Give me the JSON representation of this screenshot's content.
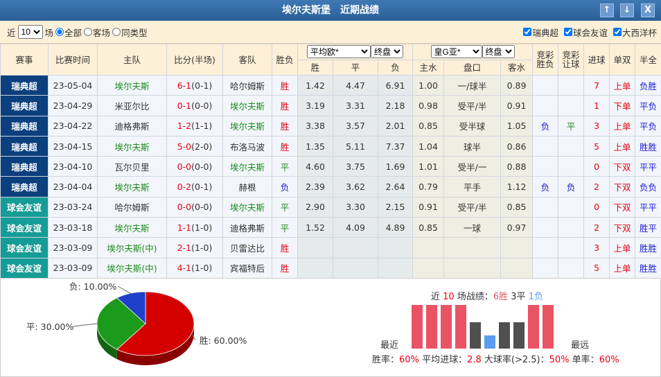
{
  "title": "埃尔夫斯堡　近期战绩",
  "titlebar_buttons": {
    "up": "↑",
    "down": "↓",
    "close": "X"
  },
  "filter": {
    "near": "近",
    "count": "10",
    "unit": "场",
    "radio": [
      "全部",
      "客场",
      "同类型"
    ],
    "checks": [
      "瑞典超",
      "球会友谊",
      "大西洋杯"
    ]
  },
  "headers": {
    "league": "赛事",
    "date": "比赛时间",
    "home": "主队",
    "score": "比分(半场)",
    "away": "客队",
    "result": "胜负",
    "euro_select": "平均欧*",
    "euro_stage": "终盘",
    "asia_select": "皇G亚*",
    "asia_stage": "终盘",
    "win": "胜",
    "draw": "平",
    "lose": "负",
    "home_water": "主水",
    "handicap": "盘口",
    "away_water": "客水",
    "jc_result": "竞彩胜负",
    "jc_handicap": "竞彩让球",
    "goals": "进球",
    "odd_even": "单双",
    "ht_ft": "半全"
  },
  "rows": [
    {
      "league": "瑞典超",
      "lt": 1,
      "date": "23-05-04",
      "home": "埃尔夫斯",
      "hg": 1,
      "sc": "6-1",
      "ht": "(0-1)",
      "away": "哈尔姆斯",
      "ag": 0,
      "res": "胜",
      "w": "1.42",
      "d": "4.47",
      "l": "6.91",
      "hw": "1.00",
      "hc": "一/球半",
      "aw": "0.89",
      "jr": "",
      "jh": "",
      "goals": "7",
      "oe": "上单",
      "hf": "负胜"
    },
    {
      "league": "瑞典超",
      "lt": 1,
      "date": "23-04-29",
      "home": "米亚尔比",
      "hg": 0,
      "sc": "0-1",
      "ht": "(0-0)",
      "away": "埃尔夫斯",
      "ag": 1,
      "res": "胜",
      "w": "3.19",
      "d": "3.31",
      "l": "2.18",
      "hw": "0.98",
      "hc": "受平/半",
      "aw": "0.91",
      "jr": "",
      "jh": "",
      "goals": "1",
      "oe": "下单",
      "hf": "平负"
    },
    {
      "league": "瑞典超",
      "lt": 1,
      "date": "23-04-22",
      "home": "迪格弗斯",
      "hg": 0,
      "sc": "1-2",
      "ht": "(1-1)",
      "away": "埃尔夫斯",
      "ag": 1,
      "res": "胜",
      "w": "3.38",
      "d": "3.57",
      "l": "2.01",
      "hw": "0.85",
      "hc": "受半球",
      "aw": "1.05",
      "jr": "负",
      "jh": "平",
      "goals": "3",
      "oe": "上单",
      "hf": "平负"
    },
    {
      "league": "瑞典超",
      "lt": 1,
      "date": "23-04-15",
      "home": "埃尔夫斯",
      "hg": 1,
      "sc": "5-0",
      "ht": "(2-0)",
      "away": "布洛马波",
      "ag": 0,
      "res": "胜",
      "w": "1.35",
      "d": "5.11",
      "l": "7.37",
      "hw": "1.04",
      "hc": "球半",
      "aw": "0.86",
      "jr": "",
      "jh": "",
      "goals": "5",
      "oe": "上单",
      "hf": "胜胜"
    },
    {
      "league": "瑞典超",
      "lt": 1,
      "date": "23-04-10",
      "home": "瓦尔贝里",
      "hg": 0,
      "sc": "0-0",
      "ht": "(0-0)",
      "away": "埃尔夫斯",
      "ag": 1,
      "res": "平",
      "w": "4.60",
      "d": "3.75",
      "l": "1.69",
      "hw": "1.01",
      "hc": "受半/一",
      "aw": "0.88",
      "jr": "",
      "jh": "",
      "goals": "0",
      "oe": "下双",
      "hf": "平平"
    },
    {
      "league": "瑞典超",
      "lt": 1,
      "date": "23-04-04",
      "home": "埃尔夫斯",
      "hg": 1,
      "sc": "0-2",
      "ht": "(0-1)",
      "away": "赫根",
      "ag": 0,
      "res": "负",
      "w": "2.39",
      "d": "3.62",
      "l": "2.64",
      "hw": "0.79",
      "hc": "平手",
      "aw": "1.12",
      "jr": "负",
      "jh": "负",
      "goals": "2",
      "oe": "下双",
      "hf": "负负"
    },
    {
      "league": "球会友谊",
      "lt": 2,
      "date": "23-03-24",
      "home": "哈尔姆斯",
      "hg": 0,
      "sc": "0-0",
      "ht": "(0-0)",
      "away": "埃尔夫斯",
      "ag": 1,
      "res": "平",
      "w": "2.90",
      "d": "3.30",
      "l": "2.15",
      "hw": "0.91",
      "hc": "受平/半",
      "aw": "0.85",
      "jr": "",
      "jh": "",
      "goals": "0",
      "oe": "下双",
      "hf": "平平"
    },
    {
      "league": "球会友谊",
      "lt": 2,
      "date": "23-03-18",
      "home": "埃尔夫斯",
      "hg": 1,
      "sc": "1-1",
      "ht": "(1-0)",
      "away": "迪格弗斯",
      "ag": 0,
      "res": "平",
      "w": "1.52",
      "d": "4.09",
      "l": "4.89",
      "hw": "0.85",
      "hc": "一球",
      "aw": "0.97",
      "jr": "",
      "jh": "",
      "goals": "2",
      "oe": "下双",
      "hf": "胜平"
    },
    {
      "league": "球会友谊",
      "lt": 2,
      "date": "23-03-09",
      "home": "埃尔夫斯(中)",
      "hg": 1,
      "sc": "2-1",
      "ht": "(1-0)",
      "away": "贝雷达比",
      "ag": 0,
      "res": "胜",
      "w": "",
      "d": "",
      "l": "",
      "hw": "",
      "hc": "",
      "aw": "",
      "jr": "",
      "jh": "",
      "goals": "3",
      "oe": "上单",
      "hf": "胜胜"
    },
    {
      "league": "球会友谊",
      "lt": 2,
      "date": "23-03-09",
      "home": "埃尔夫斯(中)",
      "hg": 1,
      "sc": "4-1",
      "ht": "(1-0)",
      "away": "宾福特后",
      "ag": 0,
      "res": "胜",
      "w": "",
      "d": "",
      "l": "",
      "hw": "",
      "hc": "",
      "aw": "",
      "jr": "",
      "jh": "",
      "goals": "5",
      "oe": "上单",
      "hf": "胜胜"
    }
  ],
  "pie": {
    "slices": [
      {
        "label": "胜: 60.00%",
        "value": 60,
        "color": "#d40000"
      },
      {
        "label": "平: 30.00%",
        "value": 30,
        "color": "#1c9a1c"
      },
      {
        "label": "负: 10.00%",
        "value": 10,
        "color": "#1f3fc8"
      }
    ]
  },
  "summary": {
    "prefix": "近",
    "count": "10",
    "mid": "场战绩：",
    "wins": "6胜",
    "draws": "3平",
    "losses": "1负",
    "recent": "最近",
    "oldest": "最远",
    "stats": [
      {
        "label": "胜率：",
        "value": "60%"
      },
      {
        "label": "平均进球：",
        "value": "2.8"
      },
      {
        "label": "大球率(>2.5)：",
        "value": "50%"
      },
      {
        "label": "单率：",
        "value": "60%"
      }
    ],
    "sequence": [
      "胜",
      "胜",
      "胜",
      "胜",
      "平",
      "负",
      "平",
      "平",
      "胜",
      "胜"
    ],
    "colors": {
      "胜": "#ea5364",
      "平": "#505050",
      "负": "#5b9cf0"
    }
  }
}
